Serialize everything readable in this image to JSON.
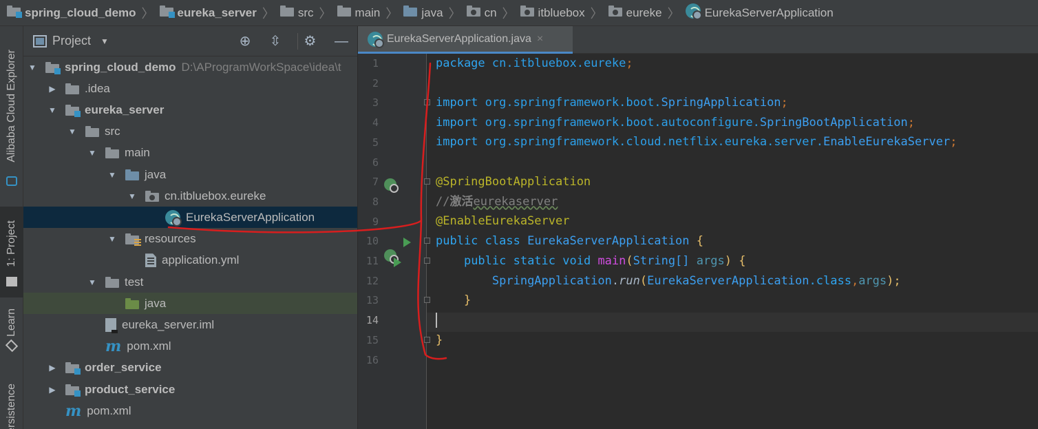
{
  "breadcrumb": [
    {
      "label": "spring_cloud_demo",
      "icon": "module-folder-icon",
      "bold": true
    },
    {
      "label": "eureka_server",
      "icon": "module-folder-icon",
      "bold": true
    },
    {
      "label": "src",
      "icon": "folder-icon",
      "bold": false
    },
    {
      "label": "main",
      "icon": "folder-icon",
      "bold": false
    },
    {
      "label": "java",
      "icon": "source-folder-icon",
      "bold": false
    },
    {
      "label": "cn",
      "icon": "package-icon",
      "bold": false
    },
    {
      "label": "itbluebox",
      "icon": "package-icon",
      "bold": false
    },
    {
      "label": "eureke",
      "icon": "package-icon",
      "bold": false
    },
    {
      "label": "EurekaServerApplication",
      "icon": "spring-boot-class-icon",
      "bold": false
    }
  ],
  "left_strip": {
    "tabs": [
      {
        "label": "Alibaba Cloud Explorer",
        "icon": "alibaba-cloud-icon"
      },
      {
        "label": "1: Project",
        "icon": "folder-icon"
      },
      {
        "label": "Learn",
        "icon": "learn-icon"
      },
      {
        "label": "Persistence",
        "icon": "persistence-icon"
      }
    ]
  },
  "project_panel": {
    "title": "Project",
    "buttons": [
      "locate-icon",
      "collapse-icon",
      "gear-icon",
      "minimize-icon"
    ]
  },
  "tree": [
    {
      "label": "spring_cloud_demo",
      "path": "D:\\AProgramWorkSpace\\idea\\t",
      "level": 0,
      "expanded": true,
      "icon": "module",
      "bold": true
    },
    {
      "label": ".idea",
      "level": 1,
      "expanded": false,
      "icon": "folder",
      "bold": false
    },
    {
      "label": "eureka_server",
      "level": 1,
      "expanded": true,
      "icon": "module",
      "bold": true
    },
    {
      "label": "src",
      "level": 2,
      "expanded": true,
      "icon": "folder",
      "bold": false
    },
    {
      "label": "main",
      "level": 3,
      "expanded": true,
      "icon": "folder",
      "bold": false
    },
    {
      "label": "java",
      "level": 4,
      "expanded": true,
      "icon": "source",
      "bold": false
    },
    {
      "label": "cn.itbluebox.eureke",
      "level": 5,
      "expanded": true,
      "icon": "package",
      "bold": false
    },
    {
      "label": "EurekaServerApplication",
      "level": 6,
      "leaf": true,
      "icon": "spring",
      "bold": false,
      "selected": true
    },
    {
      "label": "resources",
      "level": 4,
      "expanded": true,
      "icon": "resources",
      "bold": false
    },
    {
      "label": "application.yml",
      "level": 5,
      "leaf": true,
      "icon": "file",
      "bold": false
    },
    {
      "label": "test",
      "level": 3,
      "expanded": true,
      "icon": "folder",
      "bold": false
    },
    {
      "label": "java",
      "level": 4,
      "leaf": true,
      "icon": "test-source",
      "bold": false,
      "highlighted": true
    },
    {
      "label": "eureka_server.iml",
      "level": 3,
      "leaf": true,
      "icon": "iml",
      "bold": false
    },
    {
      "label": "pom.xml",
      "level": 3,
      "leaf": true,
      "icon": "maven",
      "bold": false
    },
    {
      "label": "order_service",
      "level": 1,
      "expanded": false,
      "icon": "module",
      "bold": true
    },
    {
      "label": "product_service",
      "level": 1,
      "expanded": false,
      "icon": "module",
      "bold": true
    },
    {
      "label": "pom.xml",
      "level": 1,
      "leaf": true,
      "icon": "maven",
      "bold": false
    }
  ],
  "editor": {
    "tab_label": "EurekaServerApplication.java",
    "current_line": 14,
    "line_numbers": [
      "1",
      "2",
      "3",
      "4",
      "5",
      "6",
      "7",
      "8",
      "9",
      "10",
      "11",
      "12",
      "13",
      "14",
      "15",
      "16"
    ]
  },
  "code": {
    "l1_kw": "package",
    "l1_pkg": "cn.itbluebox.eureke",
    "l1_semi": ";",
    "imp_kw": "import",
    "l3_pkg": "org.springframework.boot.",
    "l3_cls": "SpringApplication",
    "l4_pkg": "org.springframework.boot.autoconfigure.",
    "l4_cls": "SpringBootApplication",
    "l5_pkg": "org.springframework.cloud.netflix.eureka.server.",
    "l5_cls": "EnableEurekaServer",
    "semi": ";",
    "l7_ann": "@SpringBootApplication",
    "l8_cmt_prefix": "//",
    "l8_cmt_cn": "激活",
    "l8_cmt_rest": "eurekaserver",
    "l9_ann": "@EnableEurekaServer",
    "l10_kw": "public class",
    "l10_cls": "EurekaServerApplication",
    "l10_brace": "{",
    "l11_kw": "public static void",
    "l11_fn": "main",
    "l11_open": "(",
    "l11_type": "String[]",
    "l11_param": "args",
    "l11_close": ")",
    "l11_brace": "{",
    "l12_cls": "SpringApplication",
    "l12_dot": ".",
    "l12_fn": "run",
    "l12_open": "(",
    "l12_arg": "EurekaServerApplication",
    "l12_class": ".class",
    "l12_comma": ",",
    "l12_param": "args",
    "l12_close": ");",
    "l13_brace": "}",
    "l15_brace": "}"
  }
}
